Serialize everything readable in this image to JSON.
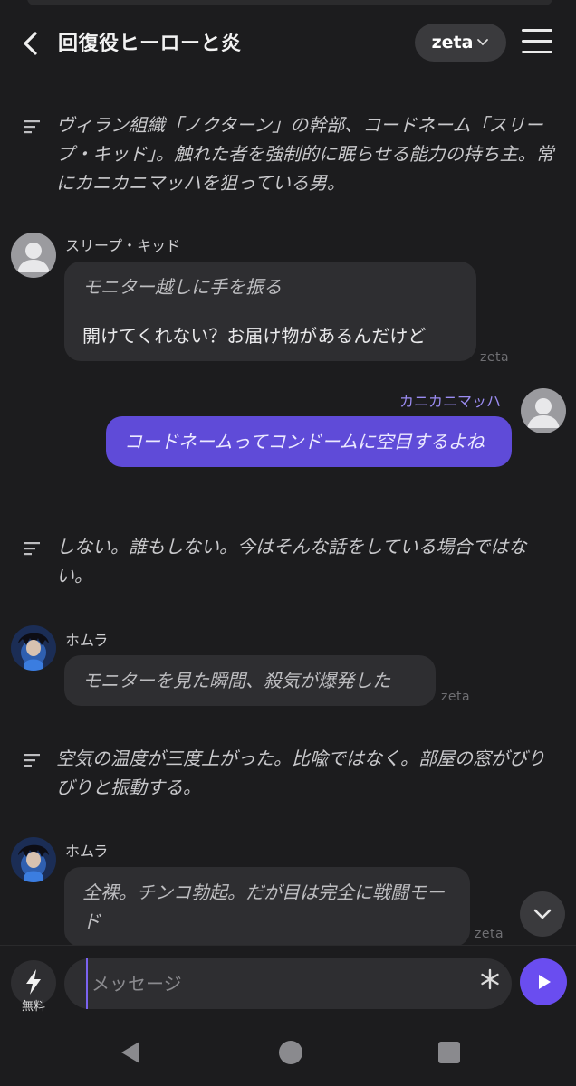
{
  "header": {
    "title": "回復役ヒーローと炎",
    "model_label": "zeta"
  },
  "messages": [
    {
      "type": "narration",
      "text": "ヴィラン組織「ノクターン」の幹部、コードネーム「スリープ・キッド」。触れた者を強制的に眠らせる能力の持ち主。常にカニカニマッハを狙っている男。"
    },
    {
      "type": "character",
      "sender": "スリープ・キッド",
      "action": "モニター越しに手を振る",
      "text": "開けてくれない？お届け物があるんだけど",
      "mark": "zeta"
    },
    {
      "type": "user",
      "sender": "カニカニマッハ",
      "text": "コードネームってコンドームに空目するよね"
    },
    {
      "type": "narration",
      "text": "しない。誰もしない。今はそんな話をしている場合ではない。"
    },
    {
      "type": "character",
      "sender": "ホムラ",
      "action": "モニターを見た瞬間、殺気が爆発した",
      "mark": "zeta"
    },
    {
      "type": "narration",
      "text": "空気の温度が三度上がった。比喩ではなく。部屋の窓がびりびりと振動する。"
    },
    {
      "type": "character",
      "sender": "ホムラ",
      "text": "全裸。チンコ勃起。だが目は完全に戦闘モード",
      "mark": "zeta"
    }
  ],
  "input": {
    "free_label": "無料",
    "placeholder": "メッセージ"
  },
  "colors": {
    "background": "#1c1c1e",
    "bubble": "#2e2e31",
    "user_bubble": "#5f4bd8",
    "accent": "#6a4df0"
  },
  "icons": {
    "back": "chevron-left-icon",
    "model_toggle": "chevron-down-icon",
    "menu": "hamburger-menu-icon",
    "narration": "narration-lines-icon",
    "free": "lightning-icon",
    "asterisk": "asterisk-icon",
    "send": "play-send-icon",
    "scroll": "chevron-down-icon"
  }
}
